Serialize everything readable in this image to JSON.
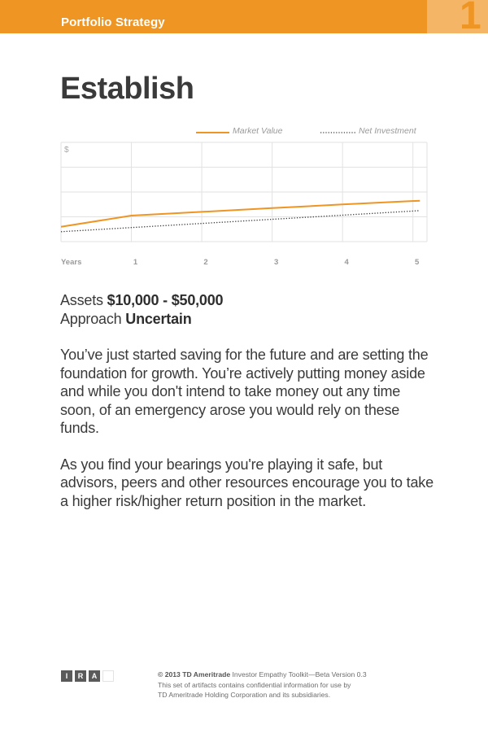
{
  "header": {
    "section_label": "Portfolio Strategy",
    "page_number": "1"
  },
  "title": "Establish",
  "chart_data": {
    "type": "line",
    "legend": [
      "Market Value",
      "Net Investment"
    ],
    "ylabel": "$",
    "xlabel": "Years",
    "x": [
      0,
      1,
      2,
      3,
      4,
      5
    ],
    "xticks": [
      "1",
      "2",
      "3",
      "4",
      "5"
    ],
    "ylim": [
      0,
      4
    ],
    "grid": true,
    "legend_position": "top-right",
    "series": [
      {
        "name": "Market Value",
        "style": "solid",
        "color": "#ee9524",
        "x": [
          0,
          1,
          2,
          3,
          4,
          5.1
        ],
        "y": [
          0.6,
          1.05,
          1.2,
          1.35,
          1.5,
          1.65
        ]
      },
      {
        "name": "Net Investment",
        "style": "dotted",
        "color": "#3a3a3a",
        "x": [
          0,
          5.1
        ],
        "y": [
          0.4,
          1.25
        ]
      }
    ]
  },
  "facts": {
    "assets_label": "Assets",
    "assets_value": "$10,000 - $50,000",
    "approach_label": "Approach",
    "approach_value": "Uncertain"
  },
  "paragraphs": [
    "You’ve just started saving for the future and are setting the foundation for growth. You’re actively putting money aside and while you don't intend to take money out any time soon, of an emergency arose you would rely on these funds.",
    "As you find your bearings you're playing it safe, but advisors, peers and other resources encourage you to take a higher risk/higher return position in the market."
  ],
  "footer": {
    "logo_letters": [
      "I",
      "R",
      "A"
    ],
    "copyright": "© 2013 TD Ameritrade",
    "toolkit": " Investor Empathy Toolkit—Beta Version 0.3",
    "line2": "This set of artifacts contains confidential information for use by",
    "line3": "TD Ameritrade Holding Corporation and its subsidiaries."
  }
}
